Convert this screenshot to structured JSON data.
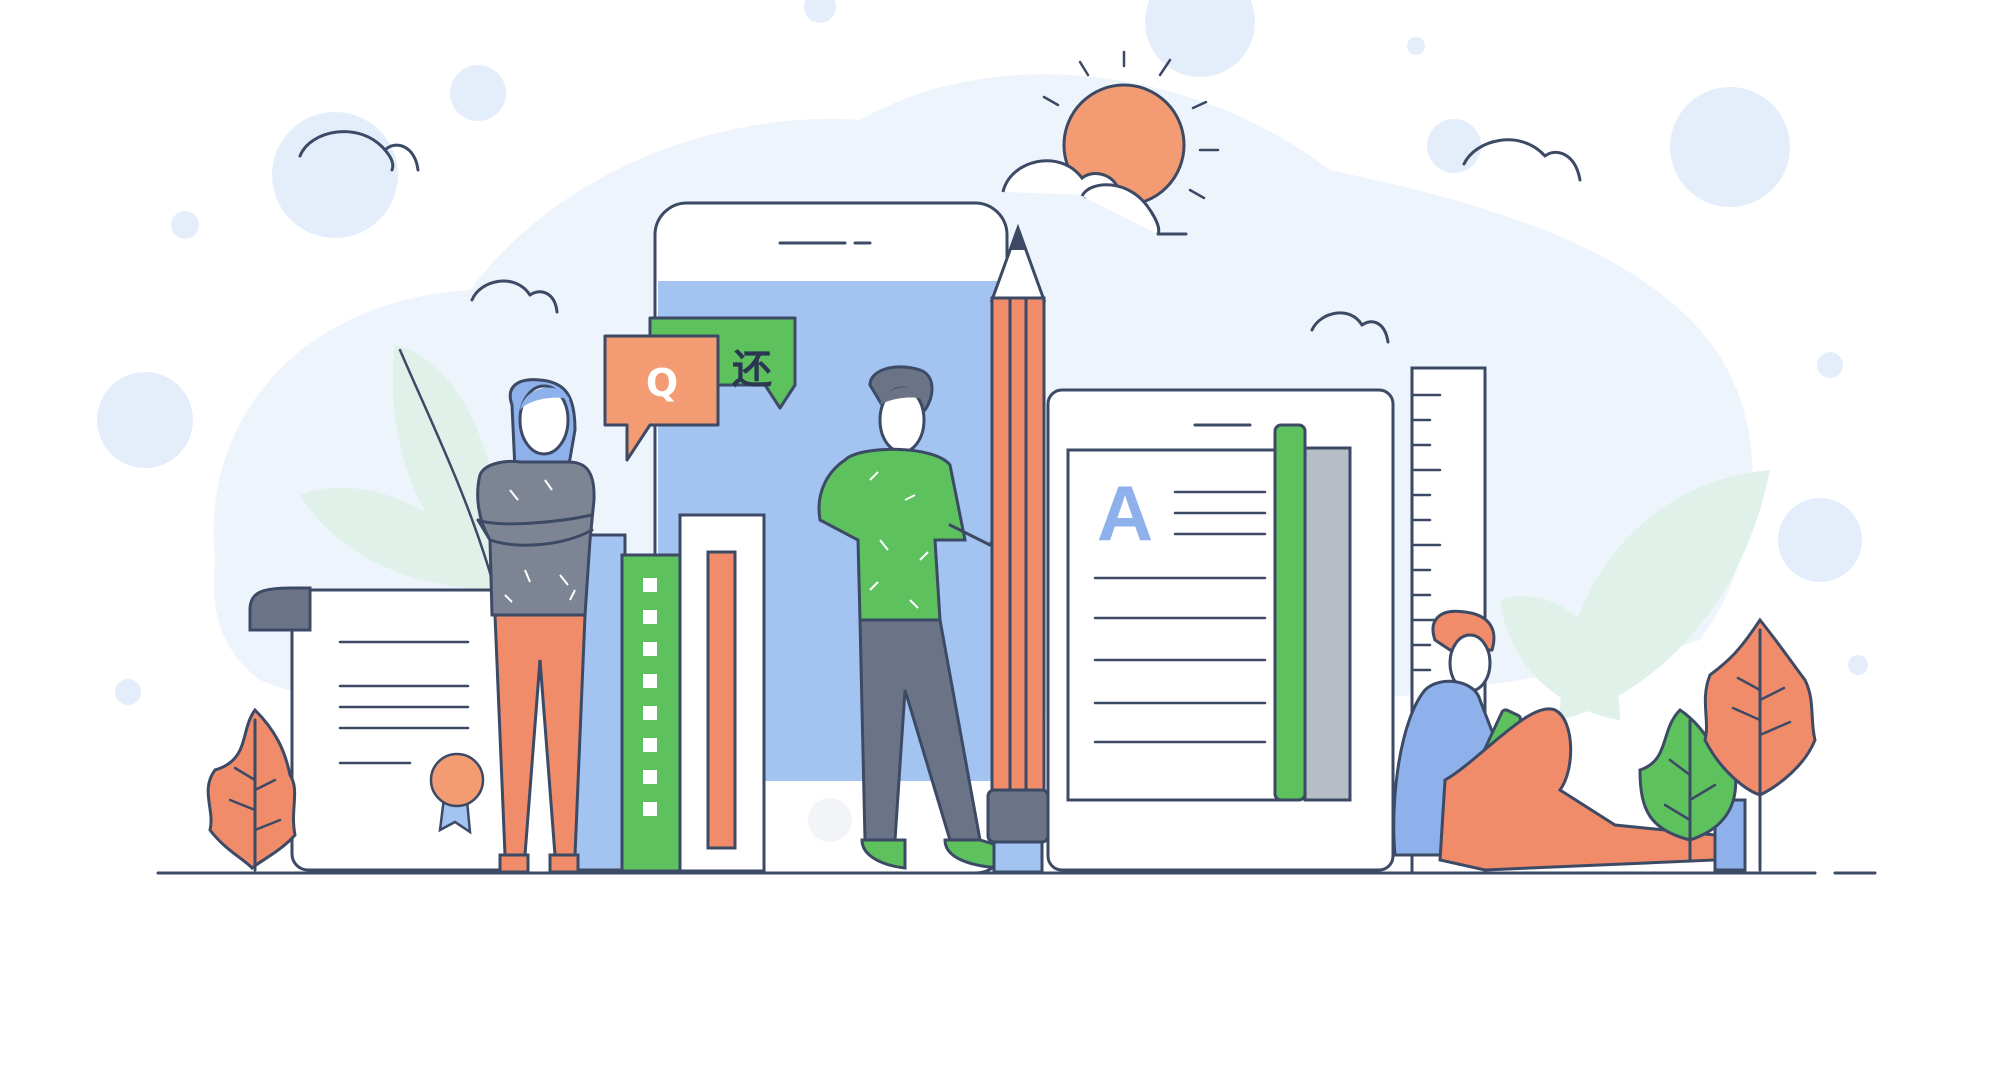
{
  "bubble_q": {
    "text": "Q"
  },
  "bubble_a": {
    "text": "还"
  },
  "book_letter": {
    "text": "A"
  },
  "colors": {
    "blob": "#edf4fd",
    "accent_orange": "#f08c6a",
    "accent_green": "#5dc15e",
    "accent_blue": "#9dc0ee",
    "outline": "#3d4a66",
    "gray": "#7d8595"
  },
  "icons": [
    "sun-icon",
    "cloud-icon",
    "leaf-icon",
    "pencil-icon",
    "ruler-icon",
    "speech-bubble-icon",
    "award-seal-icon"
  ]
}
